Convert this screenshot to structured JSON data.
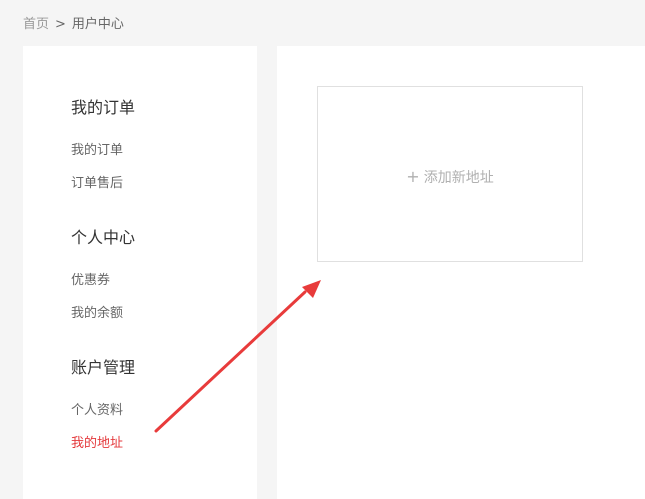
{
  "breadcrumb": {
    "home": "首页",
    "separator": ">",
    "current": "用户中心"
  },
  "sidebar": {
    "sections": [
      {
        "title": "我的订单",
        "items": [
          {
            "label": "我的订单"
          },
          {
            "label": "订单售后"
          }
        ]
      },
      {
        "title": "个人中心",
        "items": [
          {
            "label": "优惠券"
          },
          {
            "label": "我的余额"
          }
        ]
      },
      {
        "title": "账户管理",
        "items": [
          {
            "label": "个人资料"
          },
          {
            "label": "我的地址",
            "active": true
          }
        ]
      }
    ]
  },
  "main": {
    "add_card": {
      "icon": "plus-icon",
      "label": "添加新地址"
    }
  },
  "colors": {
    "active": "#e4393c",
    "annotation_arrow": "#e83b3b"
  }
}
